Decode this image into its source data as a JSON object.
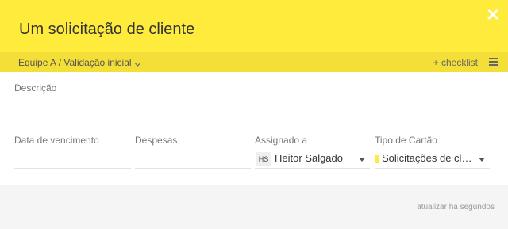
{
  "header": {
    "title": "Um solicitação de cliente",
    "background_color": "#ffeb3b",
    "close_icon": "close-icon"
  },
  "subbar": {
    "breadcrumb": "Equipe A / Validação inicial",
    "checklist_label": "+ checklist",
    "menu_icon": "hamburger-menu-icon",
    "background_color": "#f3df37"
  },
  "description": {
    "label": "Descrição",
    "value": ""
  },
  "fields": {
    "due_date": {
      "label": "Data de vencimento",
      "value": ""
    },
    "expenses": {
      "label": "Despesas",
      "value": ""
    },
    "assignee": {
      "label": "Assignado a",
      "initials": "HS",
      "name": "Heitor Salgado"
    },
    "card_type": {
      "label": "Tipo de Cartão",
      "value": "Solicitações de cliente",
      "color": "#ffeb3b"
    }
  },
  "footer": {
    "updated_text": "atualizar há segundos"
  }
}
